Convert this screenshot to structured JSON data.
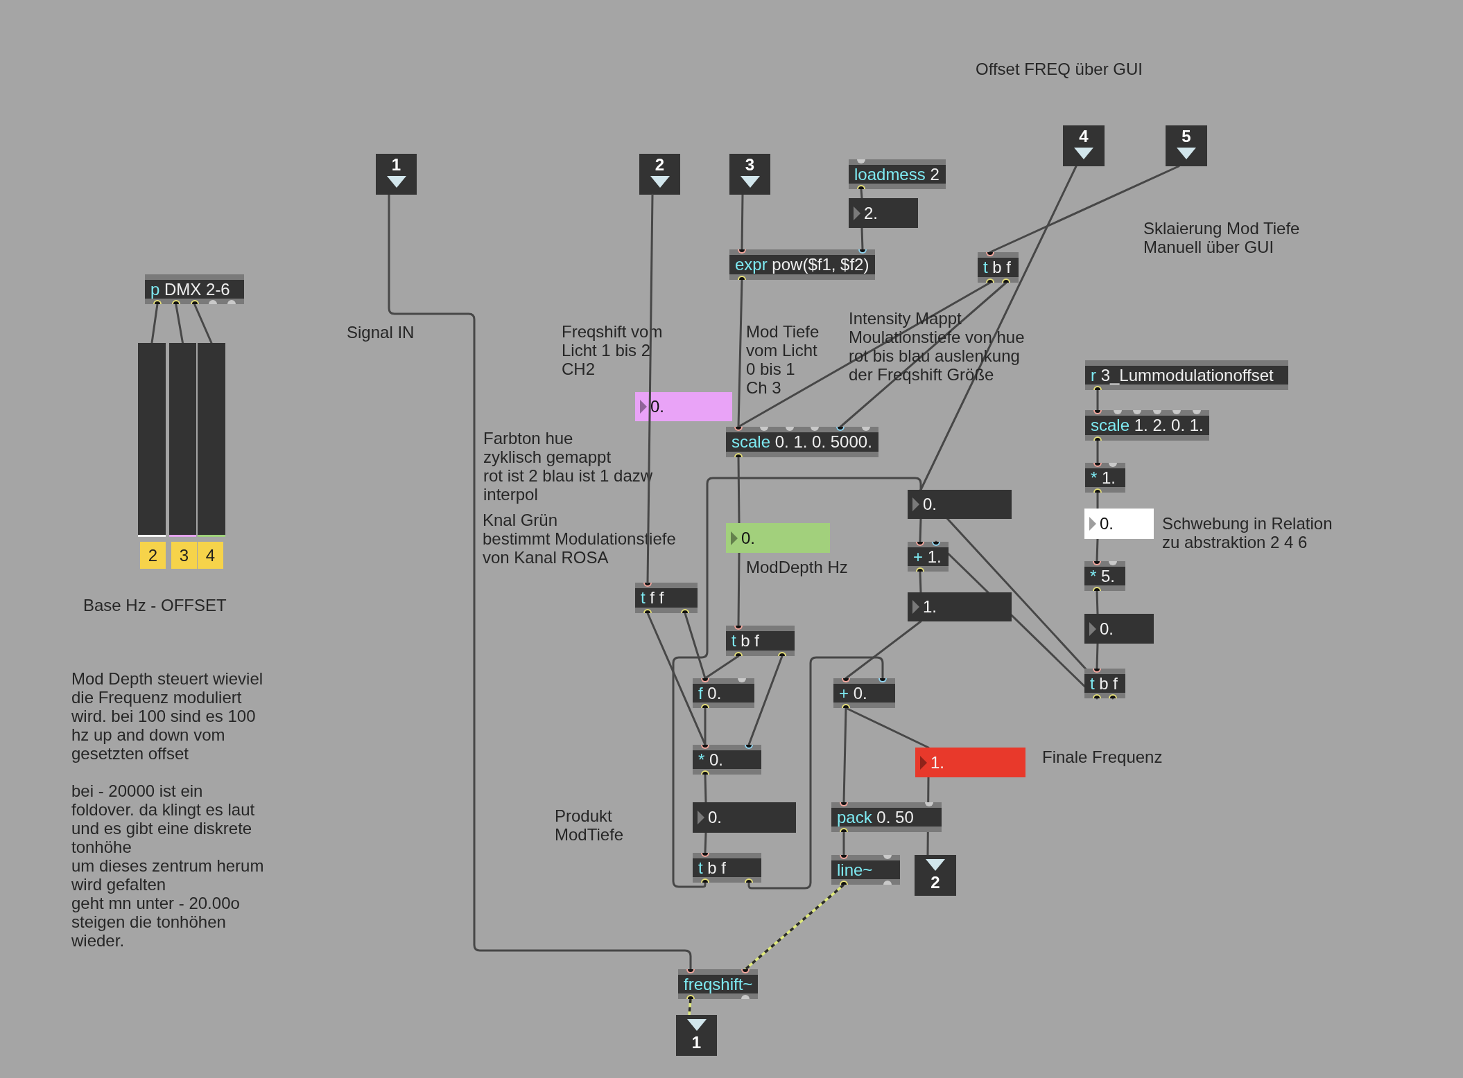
{
  "patcher": {
    "objects": [
      {
        "kind": "comment",
        "text": "Offset FREQ über GUI"
      },
      {
        "kind": "inlet",
        "label": "1"
      },
      {
        "kind": "inlet",
        "label": "2"
      },
      {
        "kind": "inlet",
        "label": "3"
      },
      {
        "kind": "object",
        "name": "loadmess",
        "args": "2",
        "inlets": [
          {
            "kind": "open"
          }
        ],
        "outlets": [
          {
            "connected": true
          }
        ]
      },
      {
        "kind": "inlet",
        "label": "4"
      },
      {
        "kind": "inlet",
        "label": "5"
      },
      {
        "kind": "number",
        "value": "2.",
        "color": "#333333"
      },
      {
        "kind": "comment",
        "text": "Sklaierung Mod Tiefe\nManuell über GUI"
      },
      {
        "kind": "object",
        "name": "p",
        "args": "DMX 2-6",
        "outlets": [
          {
            "connected": true
          },
          {
            "connected": true
          },
          {
            "connected": true
          },
          {
            "connected": false
          },
          {
            "connected": false
          }
        ]
      },
      {
        "kind": "object",
        "name": "expr",
        "args": "pow($f1, $f2)",
        "inlets": [
          {
            "kind": "hot"
          },
          {
            "kind": "cold"
          }
        ],
        "outlets": [
          {
            "connected": true
          }
        ]
      },
      {
        "kind": "object",
        "name": "t",
        "args": "b f",
        "inlets": [
          {
            "kind": "hot"
          }
        ],
        "outlets": [
          {
            "connected": true
          },
          {
            "connected": true
          }
        ]
      },
      {
        "kind": "comment",
        "text": "Signal IN"
      },
      {
        "kind": "comment",
        "text": "Freqshift vom\nLicht 1 bis 2\nCH2"
      },
      {
        "kind": "comment",
        "text": "Mod Tiefe\nvom Licht\n0 bis 1\nCh 3"
      },
      {
        "kind": "comment",
        "text": "Intensity Mappt\nMoulationstiefe von hue\nrot bis blau auslenkung\nder Freqshift Größe"
      },
      {
        "kind": "slider",
        "label": "2",
        "level": 0,
        "color": "#f4f4f4"
      },
      {
        "kind": "slider",
        "label": "3",
        "level": 0,
        "color": "#e2a4ec"
      },
      {
        "kind": "slider",
        "label": "4",
        "level": 0,
        "color": "#9fd07b"
      },
      {
        "kind": "object",
        "name": "r",
        "args": "3_Lummodulationoffset",
        "outlets": [
          {
            "connected": true
          }
        ]
      },
      {
        "kind": "number",
        "value": "0.",
        "color": "#e9a3f7"
      },
      {
        "kind": "object",
        "name": "scale",
        "args": "0. 1. 0. 5000.",
        "inlets": [
          {
            "kind": "hot"
          },
          {
            "kind": "open"
          },
          {
            "kind": "open"
          },
          {
            "kind": "open"
          },
          {
            "kind": "cold"
          },
          {
            "kind": "open"
          }
        ],
        "outlets": [
          {
            "connected": true
          }
        ]
      },
      {
        "kind": "object",
        "name": "scale",
        "args": "1. 2. 0. 1.",
        "inlets": [
          {
            "kind": "hot"
          },
          {
            "kind": "open"
          },
          {
            "kind": "open"
          },
          {
            "kind": "open"
          },
          {
            "kind": "open"
          },
          {
            "kind": "open"
          }
        ],
        "outlets": [
          {
            "connected": true
          }
        ]
      },
      {
        "kind": "comment",
        "text": "Farbton hue\nzyklisch gemappt\nrot ist 2 blau ist 1 dazw\ninterpol"
      },
      {
        "kind": "object",
        "name": "*",
        "args": "1.",
        "inlets": [
          {
            "kind": "hot"
          },
          {
            "kind": "open"
          }
        ],
        "outlets": [
          {
            "connected": true
          }
        ]
      },
      {
        "kind": "number",
        "value": "0.",
        "color": "#333333"
      },
      {
        "kind": "comment",
        "text": "Knal Grün\nbestimmt Modulationstiefe\nvon Kanal ROSA"
      },
      {
        "kind": "number",
        "value": "0.",
        "color": "#a2d07c"
      },
      {
        "kind": "number",
        "value": "0.",
        "color": "#ffffff"
      },
      {
        "kind": "comment",
        "text": "Schwebung in Relation\nzu abstraktion 2 4 6"
      },
      {
        "kind": "object",
        "name": "+",
        "args": "1.",
        "inlets": [
          {
            "kind": "hot"
          },
          {
            "kind": "cold"
          }
        ],
        "outlets": [
          {
            "connected": true
          }
        ]
      },
      {
        "kind": "comment",
        "text": "ModDepth Hz"
      },
      {
        "kind": "object",
        "name": "*",
        "args": "5.",
        "inlets": [
          {
            "kind": "hot"
          },
          {
            "kind": "open"
          }
        ],
        "outlets": [
          {
            "connected": true
          }
        ]
      },
      {
        "kind": "comment",
        "text": "Base Hz - OFFSET"
      },
      {
        "kind": "object",
        "name": "t",
        "args": "f f",
        "inlets": [
          {
            "kind": "hot"
          }
        ],
        "outlets": [
          {
            "connected": true
          },
          {
            "connected": true
          }
        ]
      },
      {
        "kind": "number",
        "value": "1.",
        "color": "#333333"
      },
      {
        "kind": "object",
        "name": "t",
        "args": "b f",
        "inlets": [
          {
            "kind": "hot"
          }
        ],
        "outlets": [
          {
            "connected": true
          },
          {
            "connected": true
          }
        ]
      },
      {
        "kind": "number",
        "value": "0.",
        "color": "#333333"
      },
      {
        "kind": "object",
        "name": "f",
        "args": "0.",
        "inlets": [
          {
            "kind": "hot"
          },
          {
            "kind": "open"
          }
        ],
        "outlets": [
          {
            "connected": true
          }
        ]
      },
      {
        "kind": "object",
        "name": "+",
        "args": "0.",
        "inlets": [
          {
            "kind": "hot"
          },
          {
            "kind": "cold"
          }
        ],
        "outlets": [
          {
            "connected": true
          }
        ]
      },
      {
        "kind": "object",
        "name": "t",
        "args": "b f",
        "inlets": [
          {
            "kind": "hot"
          }
        ],
        "outlets": [
          {
            "connected": true
          },
          {
            "connected": true
          }
        ]
      },
      {
        "kind": "comment",
        "text": "Mod Depth steuert wieviel\ndie Frequenz moduliert\nwird. bei 100 sind es 100\nhz up and down vom\ngesetzten offset\n\nbei - 20000 ist ein\nfoldover. da klingt es laut\nund es gibt eine diskrete\ntonhöhe\num dieses zentrum herum\nwird gefalten\ngeht mn unter - 20.00o\nsteigen die tonhöhen\nwieder."
      },
      {
        "kind": "object",
        "name": "*",
        "args": "0.",
        "inlets": [
          {
            "kind": "hot"
          },
          {
            "kind": "cold"
          }
        ],
        "outlets": [
          {
            "connected": true
          }
        ]
      },
      {
        "kind": "number",
        "value": "1.",
        "color": "#e8392b"
      },
      {
        "kind": "comment",
        "text": "Finale Frequenz"
      },
      {
        "kind": "comment",
        "text": "Produkt\nModTiefe"
      },
      {
        "kind": "number",
        "value": "0.",
        "color": "#333333"
      },
      {
        "kind": "object",
        "name": "pack",
        "args": "0. 50",
        "inlets": [
          {
            "kind": "hot"
          },
          {
            "kind": "open"
          }
        ],
        "outlets": [
          {
            "connected": true
          }
        ]
      },
      {
        "kind": "object",
        "name": "t",
        "args": "b f",
        "inlets": [
          {
            "kind": "hot"
          }
        ],
        "outlets": [
          {
            "connected": true
          },
          {
            "connected": true
          }
        ]
      },
      {
        "kind": "object",
        "name": "line~",
        "inlets": [
          {
            "kind": "hot"
          },
          {
            "kind": "open"
          }
        ],
        "outlets": [
          {
            "connected": true
          },
          {
            "connected": false
          }
        ]
      },
      {
        "kind": "outlet",
        "label": "2"
      },
      {
        "kind": "object",
        "name": "freqshift~",
        "inlets": [
          {
            "kind": "hot"
          },
          {
            "kind": "hot"
          }
        ],
        "outlets": [
          {
            "connected": true
          },
          {
            "connected": false
          }
        ]
      },
      {
        "kind": "outlet",
        "label": "1"
      }
    ]
  }
}
